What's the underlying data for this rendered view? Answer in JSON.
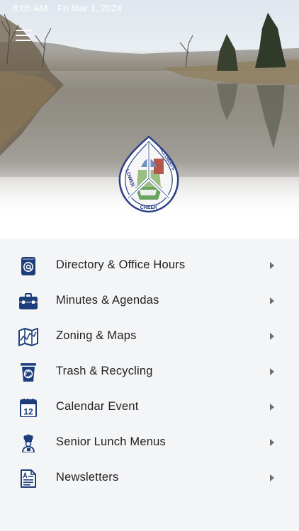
{
  "status_bar": {
    "time": "8:05 AM",
    "date": "Fri Mar 1, 2024"
  },
  "seal": {
    "top_left": "LOWER",
    "top_right": "ALLOWAYS",
    "bottom": "CREEK"
  },
  "menu_items": [
    {
      "label": "Directory & Office Hours",
      "icon": "at-sign-icon"
    },
    {
      "label": "Minutes & Agendas",
      "icon": "briefcase-icon"
    },
    {
      "label": "Zoning & Maps",
      "icon": "map-icon"
    },
    {
      "label": "Trash & Recycling",
      "icon": "recycle-bin-icon"
    },
    {
      "label": "Calendar Event",
      "icon": "calendar-icon",
      "icon_text": "12"
    },
    {
      "label": "Senior Lunch Menus",
      "icon": "chef-icon"
    },
    {
      "label": "Newsletters",
      "icon": "newsletter-icon"
    }
  ],
  "colors": {
    "icon_navy": "#1d3e7c",
    "chevron": "#6e6e6e",
    "list_bg": "#f4f5f7"
  }
}
